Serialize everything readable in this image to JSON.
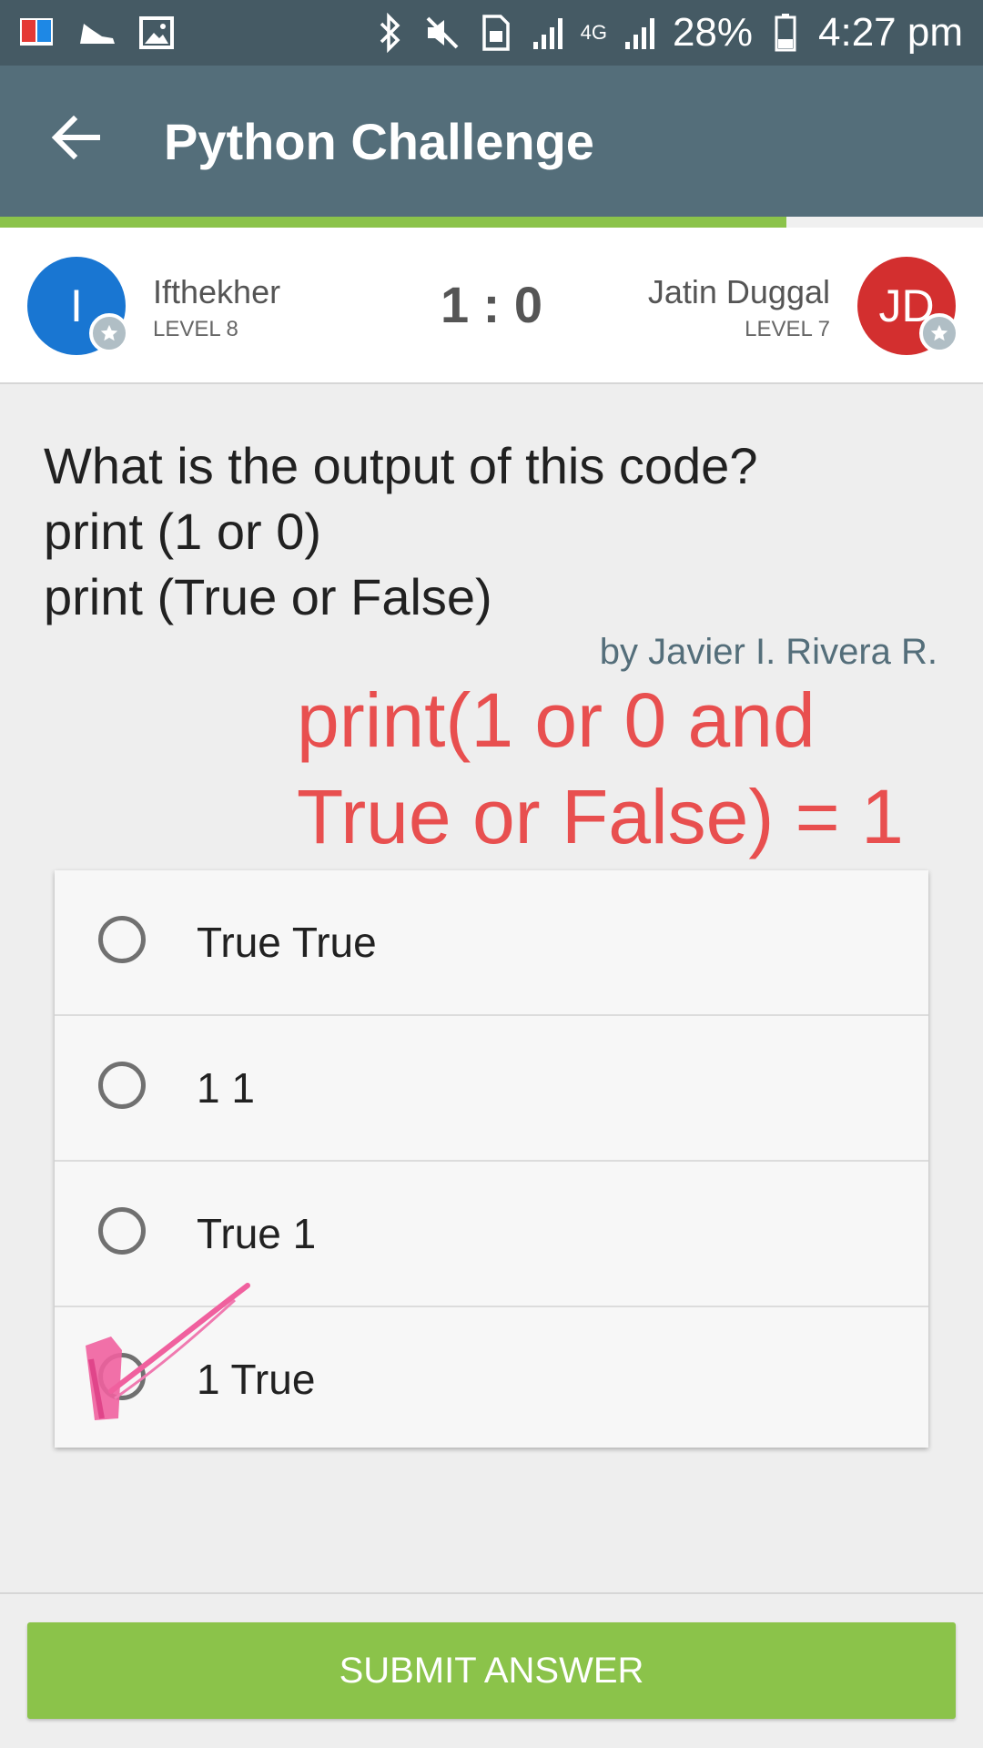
{
  "status_bar": {
    "battery": "28%",
    "time": "4:27 pm",
    "network": "4G",
    "icons": [
      "book-app-icon",
      "shoe-icon",
      "image-icon",
      "bluetooth-icon",
      "mute-icon",
      "sim-icon",
      "signal-icon",
      "battery-icon"
    ]
  },
  "app_bar": {
    "title": "Python Challenge",
    "back_icon": "arrow-left-icon"
  },
  "progress": {
    "value": 0.8
  },
  "players": {
    "left": {
      "initial": "I",
      "name": "Ifthekher",
      "level": "LEVEL 8",
      "color": "#1976d2"
    },
    "right": {
      "initial": "JD",
      "name": "Jatin Duggal",
      "level": "LEVEL 7",
      "color": "#d32f2f"
    },
    "score": "1 : 0"
  },
  "question": {
    "lines": [
      "What is the output of this code?",
      "print (1 or 0)",
      "print (True or False)"
    ],
    "author": "by Javier I. Rivera R."
  },
  "annotation": {
    "lines": [
      "print(1 or 0 and",
      "True or False) = 1"
    ],
    "color": "#e84f4f"
  },
  "options": [
    {
      "label": "True True"
    },
    {
      "label": "1 1"
    },
    {
      "label": "True 1"
    },
    {
      "label": "1 True"
    }
  ],
  "submit": {
    "label": "SUBMIT ANSWER",
    "color": "#8bc34a"
  }
}
